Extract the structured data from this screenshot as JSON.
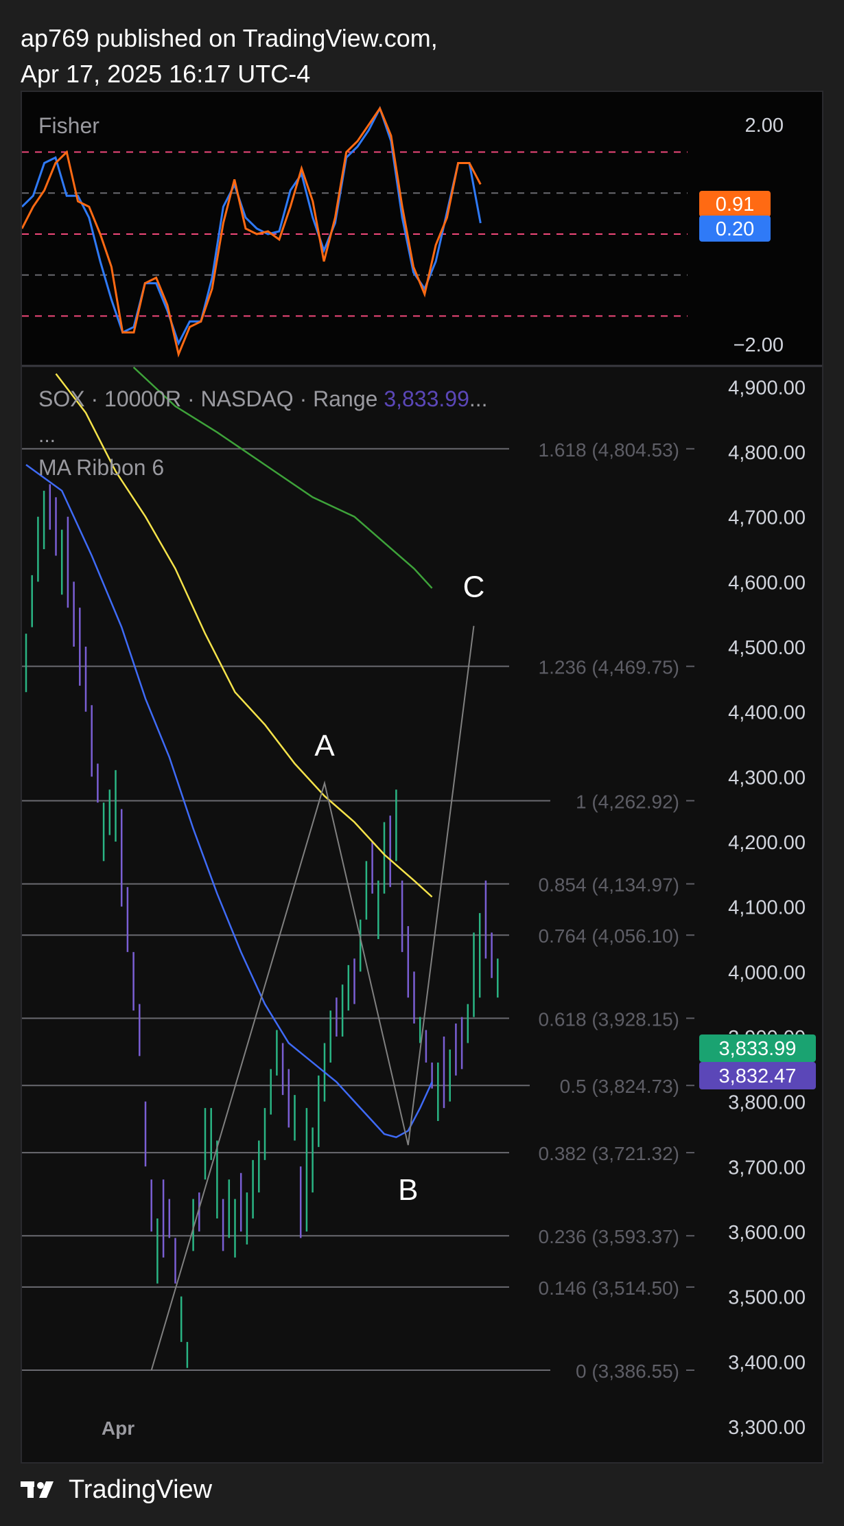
{
  "header": {
    "line1": "ap769 published on TradingView.com,",
    "line2": "Apr 17, 2025 16:17 UTC-4"
  },
  "footer": {
    "brand": "TradingView",
    "icon": "tradingview-logo-icon"
  },
  "colors": {
    "background": "#0f0f0f",
    "fisher_line": "#2f7af7",
    "trigger_line": "#ff6a13",
    "fisher_level_outer": "#f0487a",
    "fisher_level_zero": "#6a6a70",
    "bull_bar": "#2ab584",
    "bear_bar": "#7a5fd4",
    "ma_fast": "#3f6bf7",
    "ma_mid": "#f5e34a",
    "ma_slow": "#3ea33a",
    "fib_line": "#6a6a70",
    "fib_label": "#5e5e66",
    "abc_line": "#808080",
    "last_price_bg": "#1aa371",
    "ma_value_bg": "#5b47b8",
    "fisher_tag_bg": "#ff6a13",
    "trigger_tag_bg": "#2f7af7"
  },
  "chart_data": [
    {
      "type": "line",
      "title": "Fisher",
      "y_ticks": [
        "2.00",
        "−2.00"
      ],
      "levels": [
        1.5,
        0.75,
        0,
        -0.75,
        -1.5
      ],
      "ylim": [
        -2.4,
        2.6
      ],
      "current_values": {
        "orange": "0.91",
        "blue": "0.20"
      },
      "series": [
        {
          "color_key": "fisher_line",
          "values": [
            0.5,
            0.7,
            1.3,
            1.4,
            0.7,
            0.7,
            0.3,
            -0.5,
            -1.2,
            -1.8,
            -1.7,
            -0.9,
            -0.9,
            -1.4,
            -2.0,
            -1.6,
            -1.6,
            -0.8,
            0.5,
            0.9,
            0.3,
            0.1,
            0,
            0.05,
            0.8,
            1.1,
            0.3,
            -0.3,
            0.2,
            1.4,
            1.6,
            1.9,
            2.3,
            1.7,
            0.3,
            -0.7,
            -1.0,
            -0.5,
            0.4,
            1.3,
            1.3,
            0.2
          ]
        },
        {
          "color_key": "trigger_line",
          "values": [
            0.1,
            0.5,
            0.8,
            1.3,
            1.5,
            0.6,
            0.5,
            0,
            -0.6,
            -1.8,
            -1.8,
            -0.9,
            -0.8,
            -1.3,
            -2.2,
            -1.7,
            -1.6,
            -1.0,
            0.2,
            1.0,
            0.1,
            0,
            0.05,
            -0.1,
            0.5,
            1.2,
            0.6,
            -0.5,
            0.3,
            1.5,
            1.7,
            2.0,
            2.3,
            1.8,
            0.5,
            -0.6,
            -1.1,
            -0.2,
            0.3,
            1.3,
            1.3,
            0.91
          ]
        }
      ]
    },
    {
      "type": "bar",
      "title": "SOX · 10000R · NASDAQ · Range",
      "last_value_label": "3,833.99",
      "ellipsis": "...",
      "extra_line": "...",
      "indicator_label": "MA Ribbon 6",
      "x_ticks": [
        "Apr"
      ],
      "ylim": [
        3245,
        4930
      ],
      "y_ticks": [
        "4,900.00",
        "4,800.00",
        "4,700.00",
        "4,600.00",
        "4,500.00",
        "4,400.00",
        "4,300.00",
        "4,200.00",
        "4,100.00",
        "4,000.00",
        "3,900.00",
        "3,800.00",
        "3,700.00",
        "3,600.00",
        "3,500.00",
        "3,400.00",
        "3,300.00"
      ],
      "y_tick_values": [
        4900,
        4800,
        4700,
        4600,
        4500,
        4400,
        4300,
        4200,
        4100,
        4000,
        3900,
        3800,
        3700,
        3600,
        3500,
        3400,
        3300
      ],
      "price_tags": [
        {
          "value": 3833.99,
          "label": "3,833.99",
          "color_key": "last_price_bg"
        },
        {
          "value": 3832.47,
          "label": "3,832.47",
          "color_key": "ma_value_bg"
        }
      ],
      "fib_levels": [
        {
          "value": 4804.53,
          "label": "1.618 (4,804.53)"
        },
        {
          "value": 4469.75,
          "label": "1.236 (4,469.75)"
        },
        {
          "value": 4262.92,
          "label": "1 (4,262.92)"
        },
        {
          "value": 4134.97,
          "label": "0.854 (4,134.97)"
        },
        {
          "value": 4056.1,
          "label": "0.764 (4,056.10)"
        },
        {
          "value": 3928.15,
          "label": "0.618 (3,928.15)"
        },
        {
          "value": 3824.73,
          "label": "0.5 (3,824.73)"
        },
        {
          "value": 3721.32,
          "label": "0.382 (3,721.32)"
        },
        {
          "value": 3593.37,
          "label": "0.236 (3,593.37)"
        },
        {
          "value": 3514.5,
          "label": "0.146 (3,514.50)"
        },
        {
          "value": 3386.55,
          "label": "0 (3,386.55)"
        }
      ],
      "abc_points": [
        {
          "label": "",
          "bar": 21,
          "value": 3386.55
        },
        {
          "label": "A",
          "bar": 50,
          "value": 4290
        },
        {
          "label": "B",
          "bar": 64,
          "value": 3733
        },
        {
          "label": "C",
          "bar": 75,
          "value": 4532
        }
      ],
      "bars": [
        [
          4430,
          4520,
          1
        ],
        [
          4530,
          4610,
          1
        ],
        [
          4600,
          4700,
          1
        ],
        [
          4650,
          4740,
          1
        ],
        [
          4680,
          4750,
          0
        ],
        [
          4640,
          4730,
          0
        ],
        [
          4580,
          4680,
          1
        ],
        [
          4560,
          4700,
          0
        ],
        [
          4500,
          4600,
          0
        ],
        [
          4440,
          4560,
          0
        ],
        [
          4400,
          4500,
          0
        ],
        [
          4300,
          4410,
          0
        ],
        [
          4260,
          4320,
          0
        ],
        [
          4170,
          4260,
          1
        ],
        [
          4210,
          4280,
          1
        ],
        [
          4200,
          4310,
          1
        ],
        [
          4100,
          4250,
          0
        ],
        [
          4030,
          4130,
          0
        ],
        [
          3940,
          4030,
          0
        ],
        [
          3870,
          3950,
          0
        ],
        [
          3700,
          3800,
          0
        ],
        [
          3600,
          3680,
          0
        ],
        [
          3520,
          3620,
          1
        ],
        [
          3560,
          3680,
          0
        ],
        [
          3590,
          3650,
          0
        ],
        [
          3520,
          3590,
          0
        ],
        [
          3430,
          3500,
          1
        ],
        [
          3390,
          3430,
          1
        ],
        [
          3570,
          3650,
          1
        ],
        [
          3600,
          3660,
          0
        ],
        [
          3680,
          3790,
          1
        ],
        [
          3710,
          3790,
          1
        ],
        [
          3620,
          3740,
          1
        ],
        [
          3570,
          3650,
          0
        ],
        [
          3590,
          3680,
          1
        ],
        [
          3560,
          3650,
          1
        ],
        [
          3600,
          3690,
          0
        ],
        [
          3580,
          3660,
          1
        ],
        [
          3620,
          3710,
          1
        ],
        [
          3660,
          3740,
          1
        ],
        [
          3710,
          3790,
          1
        ],
        [
          3780,
          3850,
          1
        ],
        [
          3840,
          3910,
          1
        ],
        [
          3810,
          3890,
          0
        ],
        [
          3760,
          3850,
          0
        ],
        [
          3740,
          3810,
          1
        ],
        [
          3590,
          3700,
          0
        ],
        [
          3600,
          3790,
          1
        ],
        [
          3660,
          3760,
          1
        ],
        [
          3730,
          3840,
          1
        ],
        [
          3800,
          3890,
          1
        ],
        [
          3860,
          3940,
          1
        ],
        [
          3900,
          3960,
          0
        ],
        [
          3900,
          3980,
          1
        ],
        [
          3940,
          4010,
          1
        ],
        [
          3950,
          4020,
          0
        ],
        [
          4000,
          4080,
          1
        ],
        [
          4080,
          4170,
          1
        ],
        [
          4120,
          4200,
          0
        ],
        [
          4050,
          4140,
          1
        ],
        [
          4120,
          4230,
          1
        ],
        [
          4130,
          4240,
          0
        ],
        [
          4170,
          4280,
          1
        ],
        [
          4030,
          4140,
          0
        ],
        [
          3960,
          4070,
          0
        ],
        [
          3920,
          4000,
          0
        ],
        [
          3890,
          3930,
          1
        ],
        [
          3860,
          3910,
          0
        ],
        [
          3820,
          3860,
          0
        ],
        [
          3770,
          3860,
          1
        ],
        [
          3790,
          3900,
          0
        ],
        [
          3800,
          3880,
          1
        ],
        [
          3840,
          3920,
          0
        ],
        [
          3850,
          3930,
          0
        ],
        [
          3890,
          3950,
          1
        ],
        [
          3930,
          4060,
          1
        ],
        [
          3960,
          4090,
          1
        ],
        [
          4020,
          4140,
          0
        ],
        [
          3990,
          4060,
          0
        ],
        [
          3960,
          4020,
          1
        ]
      ],
      "ma_fast": [
        [
          0,
          4780
        ],
        [
          6,
          4740
        ],
        [
          11,
          4640
        ],
        [
          16,
          4530
        ],
        [
          20,
          4420
        ],
        [
          24,
          4330
        ],
        [
          28,
          4220
        ],
        [
          32,
          4120
        ],
        [
          36,
          4030
        ],
        [
          40,
          3950
        ],
        [
          44,
          3890
        ],
        [
          48,
          3860
        ],
        [
          52,
          3830
        ],
        [
          56,
          3790
        ],
        [
          58,
          3770
        ],
        [
          60,
          3750
        ],
        [
          62,
          3745
        ],
        [
          64,
          3755
        ],
        [
          66,
          3790
        ],
        [
          68,
          3830
        ]
      ],
      "ma_mid": [
        [
          5,
          4920
        ],
        [
          10,
          4860
        ],
        [
          15,
          4770
        ],
        [
          20,
          4700
        ],
        [
          25,
          4620
        ],
        [
          30,
          4520
        ],
        [
          35,
          4430
        ],
        [
          40,
          4380
        ],
        [
          45,
          4320
        ],
        [
          50,
          4270
        ],
        [
          55,
          4230
        ],
        [
          60,
          4180
        ],
        [
          65,
          4140
        ],
        [
          68,
          4115
        ]
      ],
      "ma_slow": [
        [
          18,
          4930
        ],
        [
          25,
          4870
        ],
        [
          32,
          4830
        ],
        [
          40,
          4780
        ],
        [
          48,
          4730
        ],
        [
          55,
          4700
        ],
        [
          60,
          4660
        ],
        [
          65,
          4620
        ],
        [
          68,
          4590
        ]
      ]
    }
  ]
}
